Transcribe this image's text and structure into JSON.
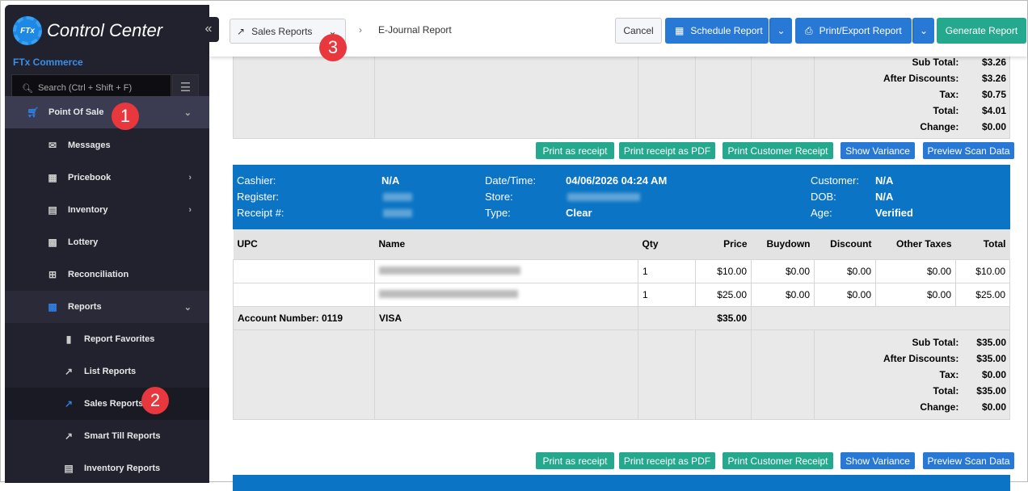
{
  "sidebar": {
    "logo_badge": "FTx",
    "logo_text": "Control Center",
    "org": "FTx Commerce",
    "search_placeholder": "Search (Ctrl + Shift + F)",
    "items": [
      {
        "label": "Point Of Sale"
      },
      {
        "label": "Messages"
      },
      {
        "label": "Pricebook"
      },
      {
        "label": "Inventory"
      },
      {
        "label": "Lottery"
      },
      {
        "label": "Reconciliation"
      },
      {
        "label": "Reports"
      },
      {
        "label": "Report Favorites"
      },
      {
        "label": "List Reports"
      },
      {
        "label": "Sales Reports"
      },
      {
        "label": "Smart Till Reports"
      },
      {
        "label": "Inventory Reports"
      }
    ]
  },
  "badges": [
    "1",
    "2",
    "3"
  ],
  "header": {
    "crumb": "Sales Reports",
    "current": "E-Journal Report",
    "cancel": "Cancel",
    "schedule": "Schedule Report",
    "print_export": "Print/Export Report",
    "generate": "Generate Report"
  },
  "actions": {
    "print_receipt": "Print as receipt",
    "print_pdf": "Print receipt as PDF",
    "print_customer": "Print Customer Receipt",
    "show_variance": "Show Variance",
    "preview_scan": "Preview Scan Data"
  },
  "prev_totals": [
    {
      "label": "Sub Total:",
      "value": "$3.26"
    },
    {
      "label": "After Discounts:",
      "value": "$3.26"
    },
    {
      "label": "Tax:",
      "value": "$0.75"
    },
    {
      "label": "Total:",
      "value": "$4.01"
    },
    {
      "label": "Change:",
      "value": "$0.00"
    }
  ],
  "receipt": {
    "labels": {
      "cashier": "Cashier:",
      "register": "Register:",
      "receipt": "Receipt #:",
      "datetime": "Date/Time:",
      "store": "Store:",
      "type": "Type:",
      "customer": "Customer:",
      "dob": "DOB:",
      "age": "Age:"
    },
    "cashier": "N/A",
    "datetime": "04/06/2026 04:24 AM",
    "type": "Clear",
    "customer": "N/A",
    "dob": "N/A",
    "age": "Verified",
    "columns": [
      "UPC",
      "Name",
      "Qty",
      "Price",
      "Buydown",
      "Discount",
      "Other Taxes",
      "Total"
    ],
    "rows": [
      {
        "qty": "1",
        "price": "$10.00",
        "buydown": "$0.00",
        "discount": "$0.00",
        "other": "$0.00",
        "total": "$10.00"
      },
      {
        "qty": "1",
        "price": "$25.00",
        "buydown": "$0.00",
        "discount": "$0.00",
        "other": "$0.00",
        "total": "$25.00"
      }
    ],
    "payment": {
      "account": "Account Number: 0119",
      "method": "VISA",
      "amount": "$35.00"
    },
    "totals": [
      {
        "label": "Sub Total:",
        "value": "$35.00"
      },
      {
        "label": "After Discounts:",
        "value": "$35.00"
      },
      {
        "label": "Tax:",
        "value": "$0.00"
      },
      {
        "label": "Total:",
        "value": "$35.00"
      },
      {
        "label": "Change:",
        "value": "$0.00"
      }
    ]
  }
}
